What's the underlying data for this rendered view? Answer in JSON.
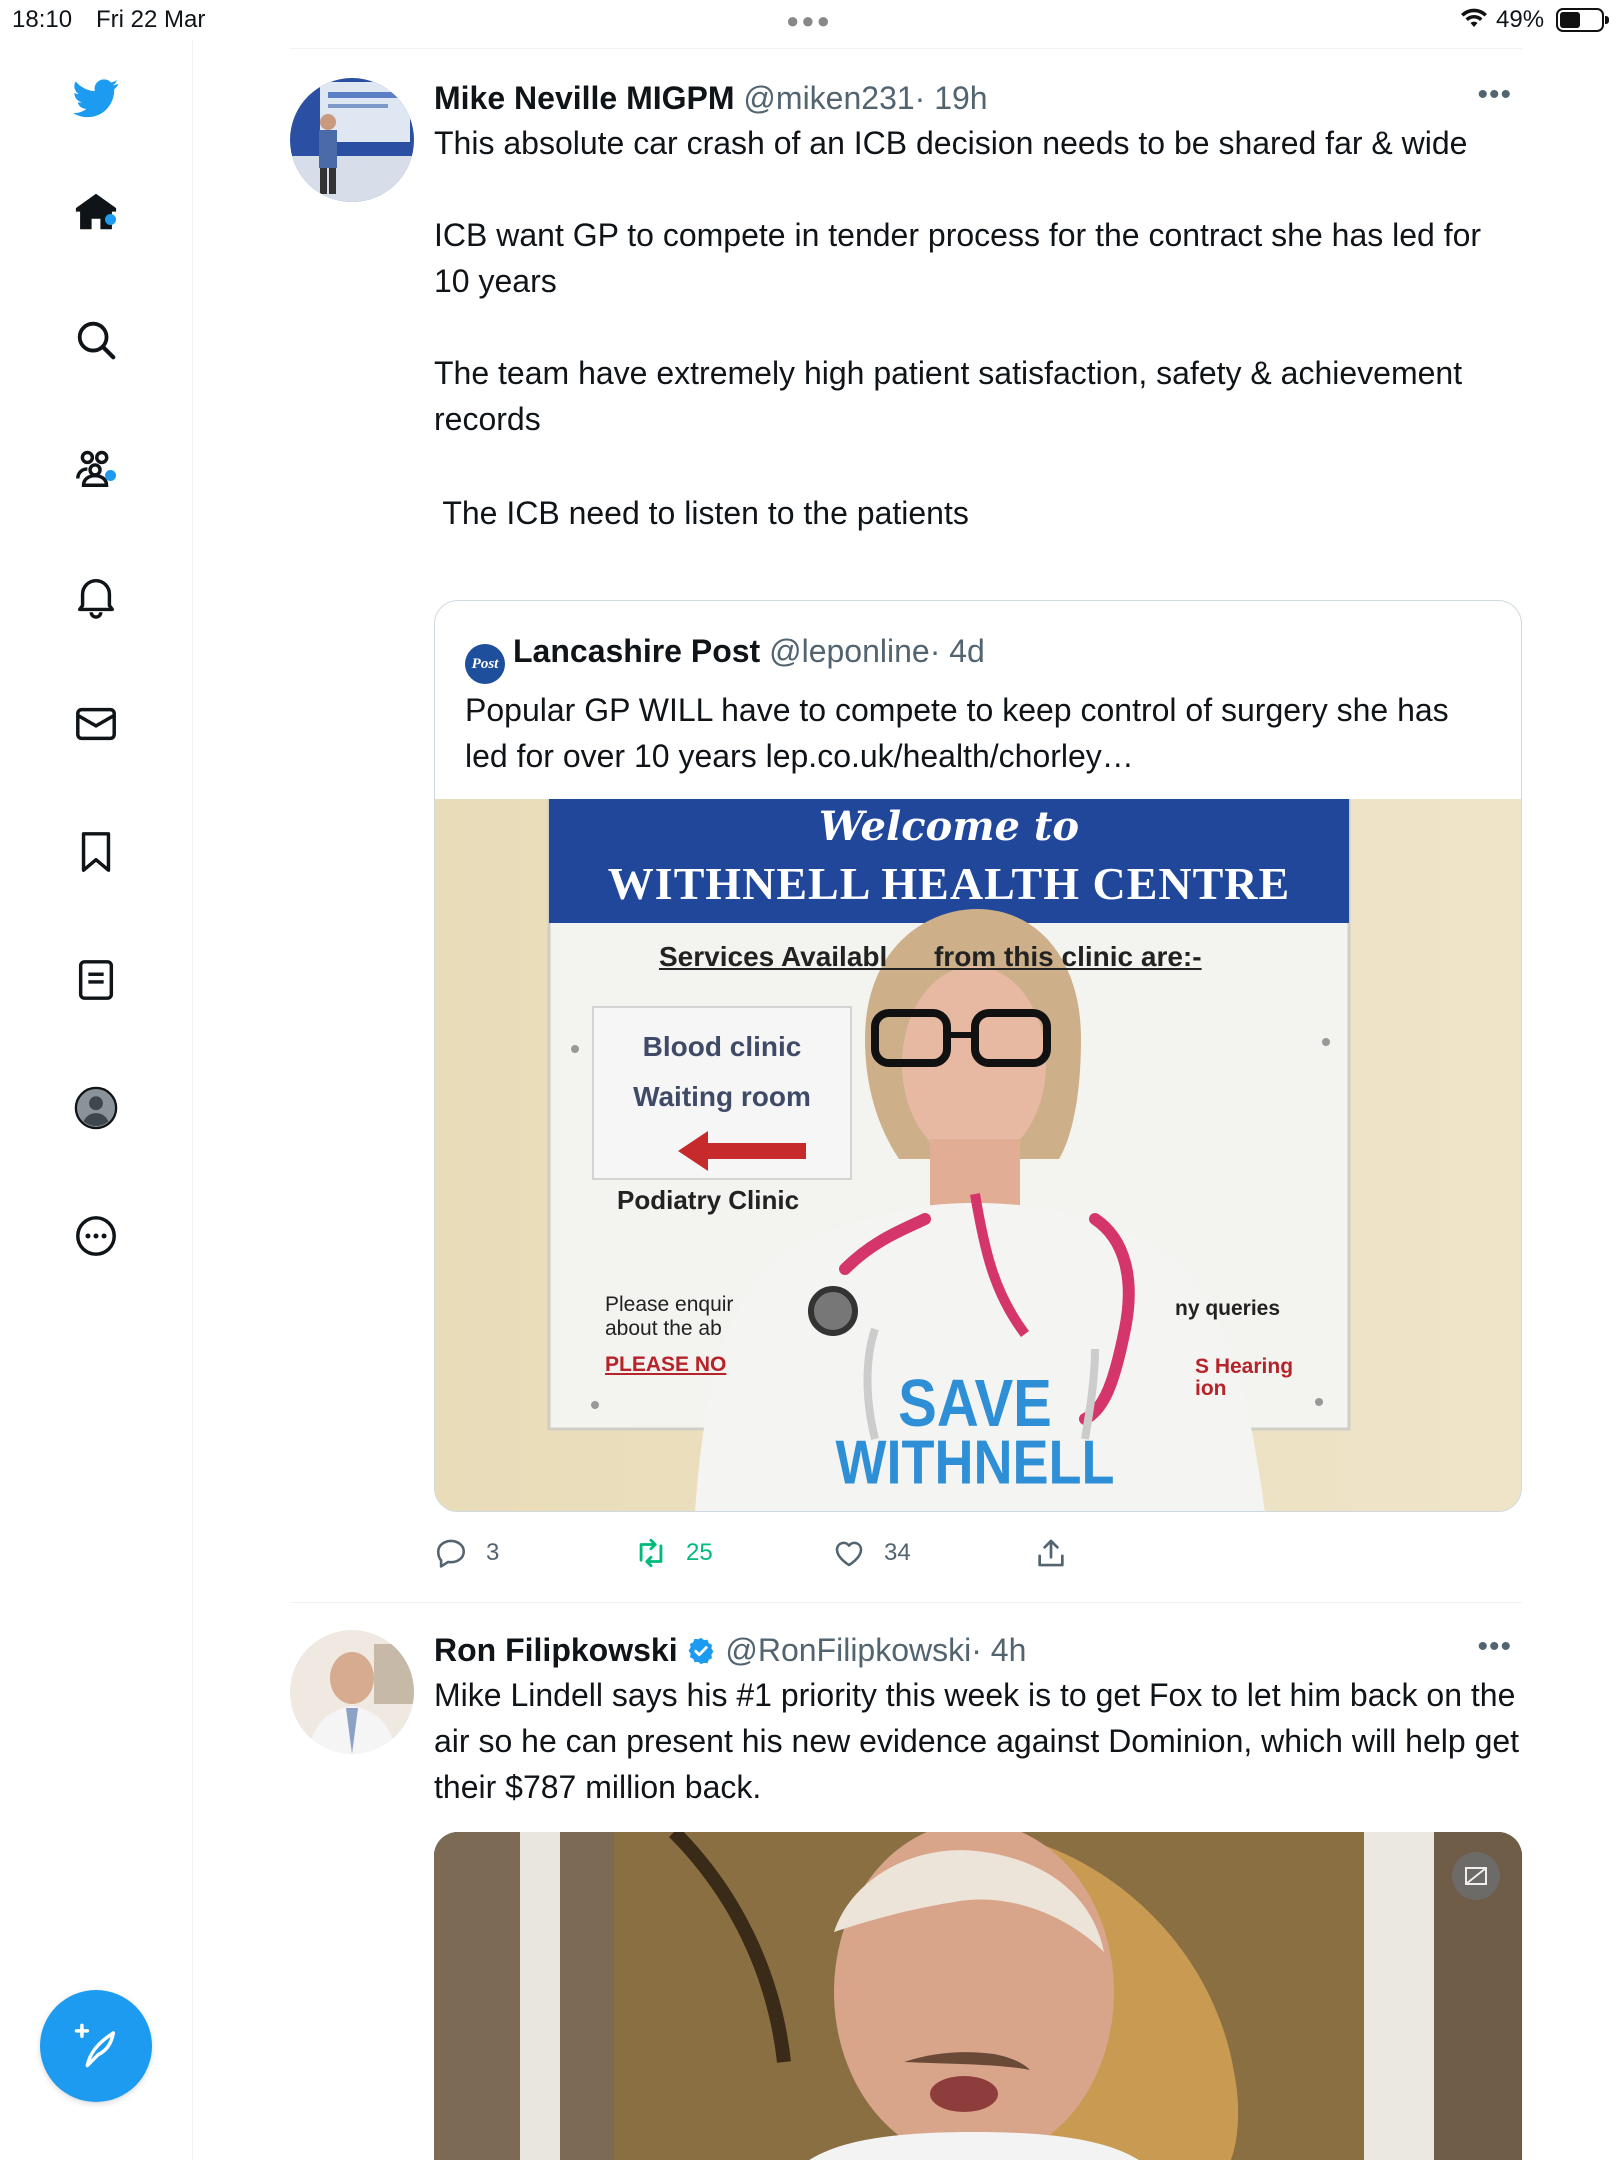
{
  "status_bar": {
    "time": "18:10",
    "date": "Fri 22 Mar",
    "battery_percent": "49%",
    "battery_level": 0.49
  },
  "sidebar": {
    "items": [
      {
        "icon": "twitter-logo-icon"
      },
      {
        "icon": "home-icon",
        "has_notification": true
      },
      {
        "icon": "search-icon"
      },
      {
        "icon": "communities-icon",
        "has_notification": true
      },
      {
        "icon": "bell-icon"
      },
      {
        "icon": "mail-icon"
      },
      {
        "icon": "bookmark-icon"
      },
      {
        "icon": "lists-icon"
      },
      {
        "icon": "profile-icon"
      },
      {
        "icon": "more-icon"
      }
    ],
    "compose_icon": "compose-feather-icon"
  },
  "colors": {
    "accent": "#1d9bf0",
    "retweet_green": "#00ba7c",
    "muted": "#536471"
  },
  "tweets": [
    {
      "name": "Mike Neville MIGPM",
      "handle": "@miken231",
      "time": "· 19h",
      "paragraphs": [
        "This absolute car crash of an ICB decision needs to be shared far & wide",
        "",
        "ICB want GP to compete in tender process for the contract she has led for 10 years",
        "",
        "The team have extremely high patient satisfaction, safety & achievement records",
        "",
        " The ICB need to listen to the patients"
      ],
      "quote": {
        "logo_text": "Post",
        "name": "Lancashire Post",
        "handle": "@leponline",
        "time": "· 4d",
        "text": "Popular GP WILL have to compete to keep control of surgery she has led for over 10 years lep.co.uk/health/chorley…",
        "photo": {
          "sign_title_script": "Welcome to",
          "sign_title": "WITHNELL HEALTH CENTRE",
          "services": "Services Availabl      from this clinic are:-",
          "left_sign_line1": "Blood clinic",
          "left_sign_line2": "Waiting room",
          "podiatry": "Podiatry Clinic",
          "enquire_1": "Please enquir",
          "enquire_2": "about the ab",
          "please_note": "PLEASE NO",
          "queries": "ny queries",
          "hearing_1": "S Hearing",
          "hearing_2": "ion",
          "shirt_1": "SAVE",
          "shirt_2": "WITHNELL"
        }
      },
      "replies": "3",
      "retweets": "25",
      "likes": "34"
    },
    {
      "name": "Ron Filipkowski",
      "verified": true,
      "handle": "@RonFilipkowski",
      "time": "· 4h",
      "paragraphs": [
        "Mike Lindell says his #1 priority this week is to get Fox to let him back on the air so he can present his new evidence against Dominion, which will help get their $787 million back."
      ]
    }
  ]
}
